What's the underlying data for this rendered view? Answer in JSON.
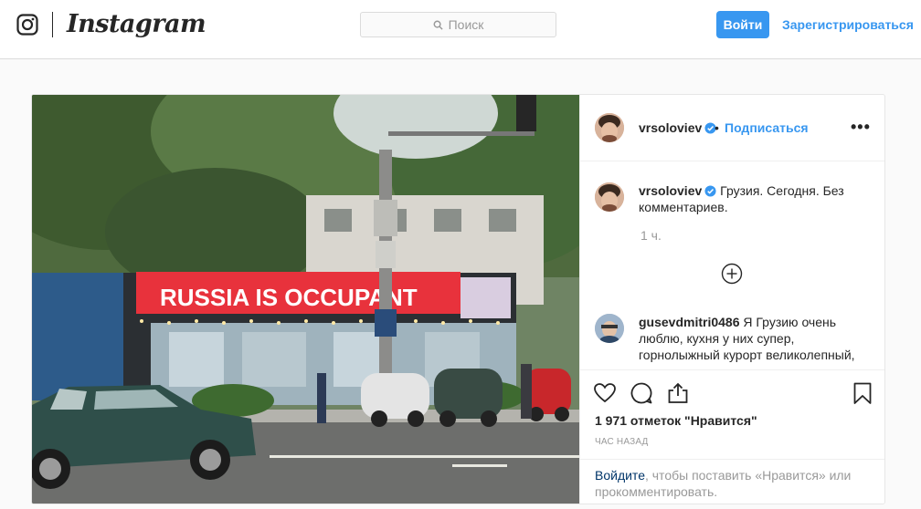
{
  "nav": {
    "logo": "Instagram",
    "search_placeholder": "Поиск",
    "login_label": "Войти",
    "register_label": "Зарегистрироваться"
  },
  "post": {
    "image_sign_text": "RUSSIA IS OCCUPANT",
    "author": "vrsoloviev",
    "dot": "•",
    "follow_label": "Подписаться",
    "more_label": "•••",
    "caption_text": "Грузия. Сегодня. Без комментариев.",
    "time": "1 ч.",
    "comments": [
      {
        "user": "gusevdmitri0486",
        "text": "Я Грузию очень люблю, кухня у них супер, горнолыжный курорт великолепный,"
      }
    ],
    "likes_text": "1 971 отметок \"Нравится\"",
    "ago_text": "ЧАС НАЗАД",
    "login_prompt_link": "Войдите",
    "login_prompt_rest": ", чтобы поставить «Нравится» или прокомментировать."
  },
  "colors": {
    "accent": "#3897f0",
    "link_dark": "#003569",
    "sign_red": "#e8323c"
  }
}
